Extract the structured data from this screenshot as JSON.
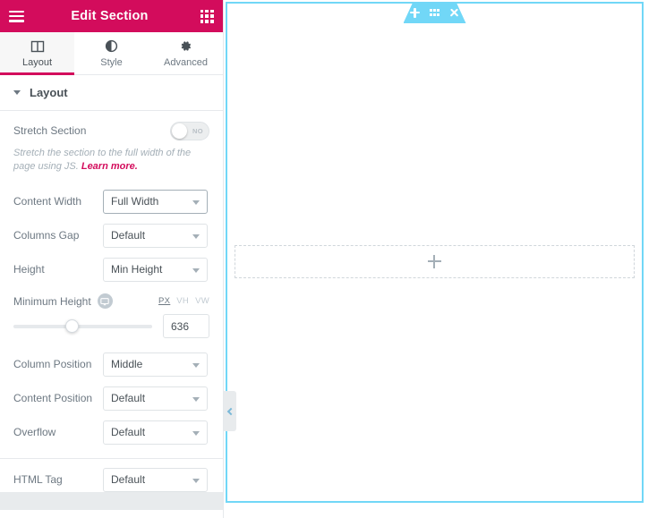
{
  "panel": {
    "header": {
      "menu_icon": "hamburger-icon",
      "title": "Edit Section",
      "widgets_icon": "grid-icon"
    },
    "tabs": [
      {
        "label": "Layout",
        "icon": "columns-icon",
        "active": true
      },
      {
        "label": "Style",
        "icon": "contrast-circle-icon",
        "active": false
      },
      {
        "label": "Advanced",
        "icon": "gear-icon",
        "active": false
      }
    ],
    "section": {
      "title": "Layout",
      "caret": "caret-down-icon"
    },
    "stretch_section": {
      "label": "Stretch Section",
      "toggle_value": "NO",
      "description_prefix": "Stretch the section to the full width of the page using JS. ",
      "link_text": "Learn more.",
      "link_color": "#d30c5c"
    },
    "fields": [
      {
        "label": "Content Width",
        "value": "Full Width",
        "focused": true
      },
      {
        "label": "Columns Gap",
        "value": "Default",
        "focused": false
      },
      {
        "label": "Height",
        "value": "Min Height",
        "focused": false
      }
    ],
    "minimum_height": {
      "label": "Minimum Height",
      "device_icon": "desktop-icon",
      "units": [
        {
          "label": "PX",
          "active": true
        },
        {
          "label": "VH",
          "active": false
        },
        {
          "label": "VW",
          "active": false
        }
      ],
      "value": "636",
      "slider_percent": 42
    },
    "fields2": [
      {
        "label": "Column Position",
        "value": "Middle",
        "focused": false
      },
      {
        "label": "Content Position",
        "value": "Default",
        "focused": false
      },
      {
        "label": "Overflow",
        "value": "Default",
        "focused": false
      }
    ],
    "html_tag": {
      "label": "HTML Tag",
      "value": "Default",
      "focused": false
    }
  },
  "canvas": {
    "section_border_color": "#71d7f7",
    "toolbar": {
      "background": "#71d7f7",
      "buttons": [
        {
          "name": "add-section-button",
          "icon": "plus-icon"
        },
        {
          "name": "drag-section-handle",
          "icon": "dots-grid-icon"
        },
        {
          "name": "delete-section-button",
          "icon": "close-icon"
        }
      ]
    },
    "dropzone": {
      "icon": "plus-icon"
    },
    "collapse_handle": {
      "icon": "chevron-left-icon"
    }
  }
}
